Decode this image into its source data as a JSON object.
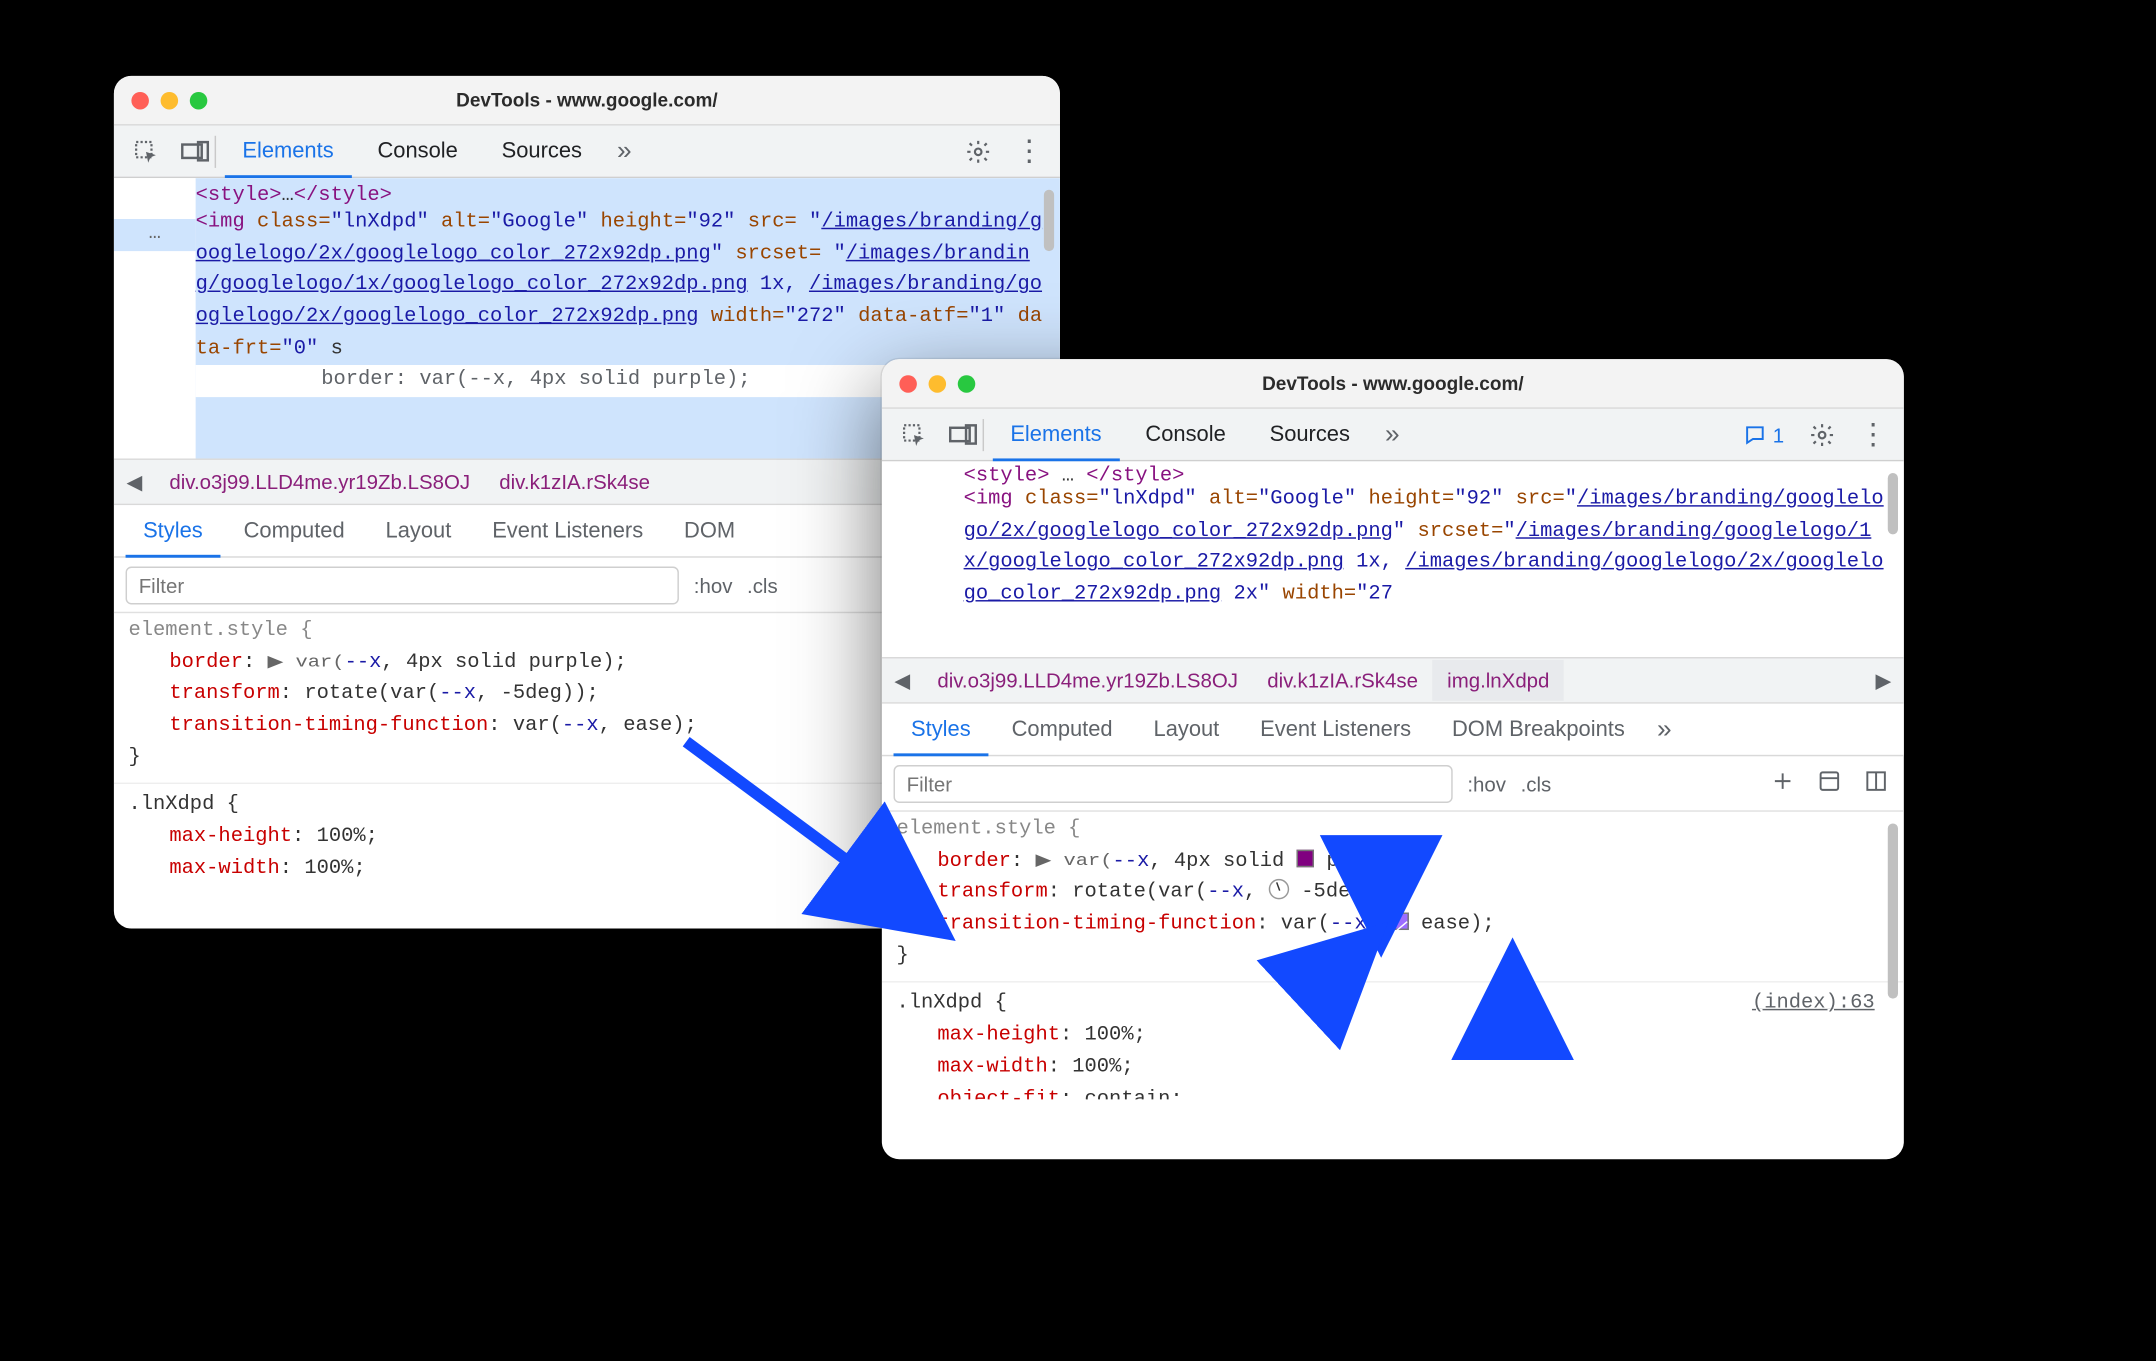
{
  "window_title": "DevTools - www.google.com/",
  "tabs": {
    "elements": "Elements",
    "console": "Console",
    "sources": "Sources",
    "more": "»"
  },
  "messages_badge": "1",
  "dom1": {
    "gutter": "…",
    "line0": "<style>…</style>",
    "img_open": "<img",
    "attr_class": "class=",
    "val_class": "\"lnXdpd\"",
    "attr_alt": "alt=",
    "val_alt": "\"Google\"",
    "attr_height": "height=",
    "val_height": "\"92\"",
    "attr_src": "src=",
    "src_link": "/images/branding/googlelogo/2x/googlelogo_color_272x92dp.png",
    "attr_srcset": "srcset=",
    "srcset_link1": "/images/branding/googlelogo/1x/googlelogo_color_272x92dp.png",
    "srcset_mid": " 1x, ",
    "srcset_link2": "/images/branding/googlelogo/2x/googlelogo_color_272x92dp.png",
    "attr_width": "width=",
    "val_width": "\"272\"",
    "attr_dataatf": "data-atf=",
    "val_dataatf": "\"1\"",
    "attr_datafrt": "data-frt=",
    "val_datafrt": "\"0\"",
    "overlay_hint": "border: var(--x, 4px solid purple);"
  },
  "dom2": {
    "srcset_tail": " 2x\"",
    "width_frag": "\"27"
  },
  "crumbs": {
    "c1": "div.o3j99.LLD4me.yr19Zb.LS8OJ",
    "c2": "div.k1zIA.rSk4se",
    "c3": "img.lnXdpd"
  },
  "panel_tabs": {
    "styles": "Styles",
    "computed": "Computed",
    "layout": "Layout",
    "listeners": "Event Listeners",
    "dombp": "DOM Breakpoints",
    "dombp_short": "DOM "
  },
  "filter": {
    "placeholder": "Filter",
    "hov": ":hov",
    "cls": ".cls"
  },
  "styles1": {
    "elstyle": "element.style {",
    "border": "border",
    "border_val_pre": "▶ var(",
    "varx": "--x",
    "comma": ", ",
    "border_val_post": "4px solid purple);",
    "transform": "transform",
    "transform_val": "rotate(var(",
    "transform_post": ", -5deg));",
    "ttf": "transition-timing-function",
    "ttf_val": "var(",
    "ttf_post": ", ease);",
    "close": "}",
    "class_rule": ".lnXdpd {",
    "mh": "max-height",
    "mh_v": "100%;",
    "mw": "max-width",
    "mw_v": "100%;"
  },
  "styles2": {
    "border_mid": "4px solid ",
    "border_end": "purple);",
    "transform_mid": "",
    "transform_end": "-5deg));",
    "ttf_end": "ease);",
    "of": "object-fit",
    "of_v": "contain;",
    "index_link": "(index):63"
  }
}
